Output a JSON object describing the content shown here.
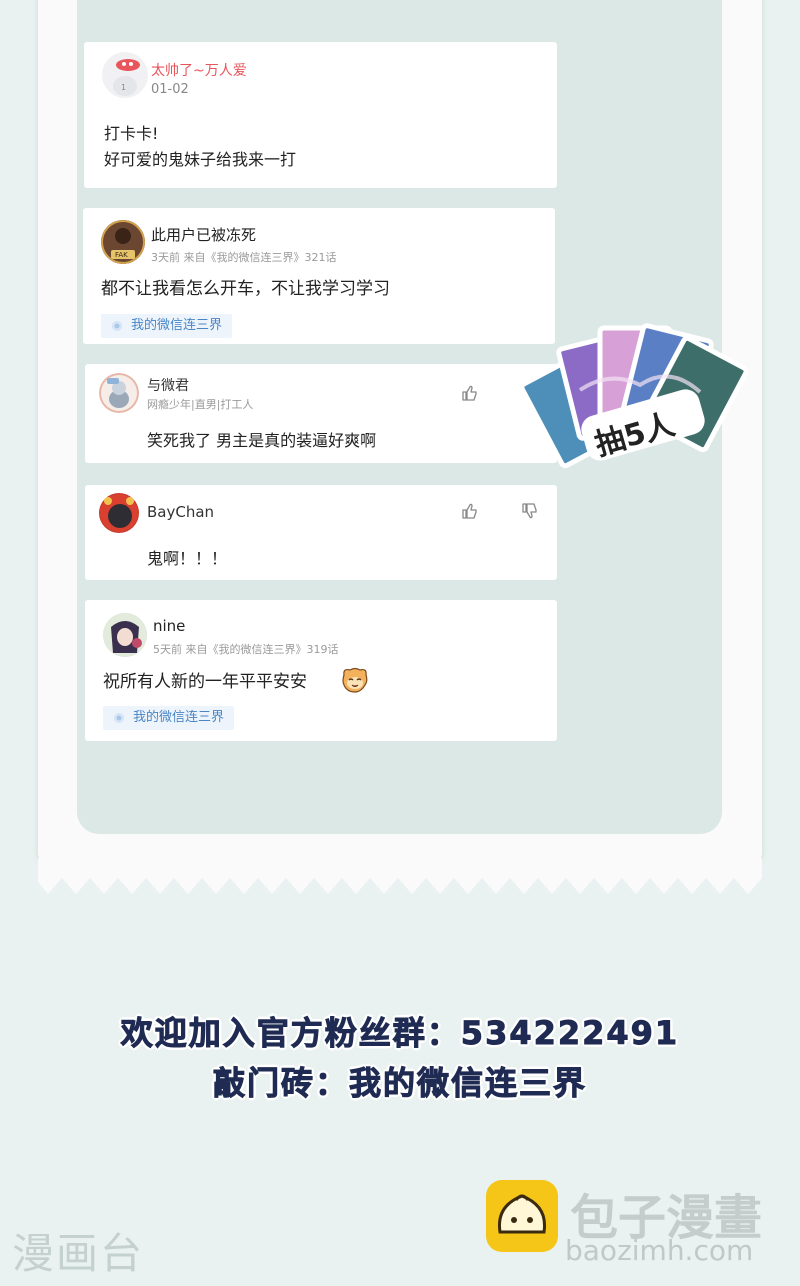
{
  "colors": {
    "background": "#e9f2f0",
    "panel": "#dce8e5",
    "vip_name": "#e8555a",
    "tag_text": "#4a86c6",
    "promo_text": "#1f2b52"
  },
  "comments": [
    {
      "username": "太帅了~万人爱",
      "date": "01-02",
      "lines": [
        "打卡卡!",
        "好可爱的鬼妹子给我来一打"
      ]
    },
    {
      "username": "此用户已被冻死",
      "meta": "3天前 来自《我的微信连三界》321话",
      "text": "都不让我看怎么开车，不让我学习学习",
      "tag": "我的微信连三界",
      "badge": "FAK"
    },
    {
      "username": "与微君",
      "meta": "网瘾少年|直男|打工人",
      "text": "笑死我了 男主是真的装逼好爽啊"
    },
    {
      "username": "BayChan",
      "text": "鬼啊！！！"
    },
    {
      "username": "nine",
      "meta": "5天前 来自《我的微信连三界》319话",
      "text": "祝所有人新的一年平平安安",
      "tag": "我的微信连三界"
    }
  ],
  "sticker": {
    "label": "抽5人"
  },
  "promo": {
    "line1": "欢迎加入官方粉丝群：534222491",
    "line2": "敲门砖：我的微信连三界"
  },
  "watermarks": {
    "left": "漫画台",
    "right": "包子漫畫",
    "url": "baozimh.com"
  },
  "icons": [
    "thumbs-up-icon",
    "thumbs-down-icon",
    "tag-dot-icon",
    "bun-logo-icon",
    "emoji-face-icon"
  ]
}
